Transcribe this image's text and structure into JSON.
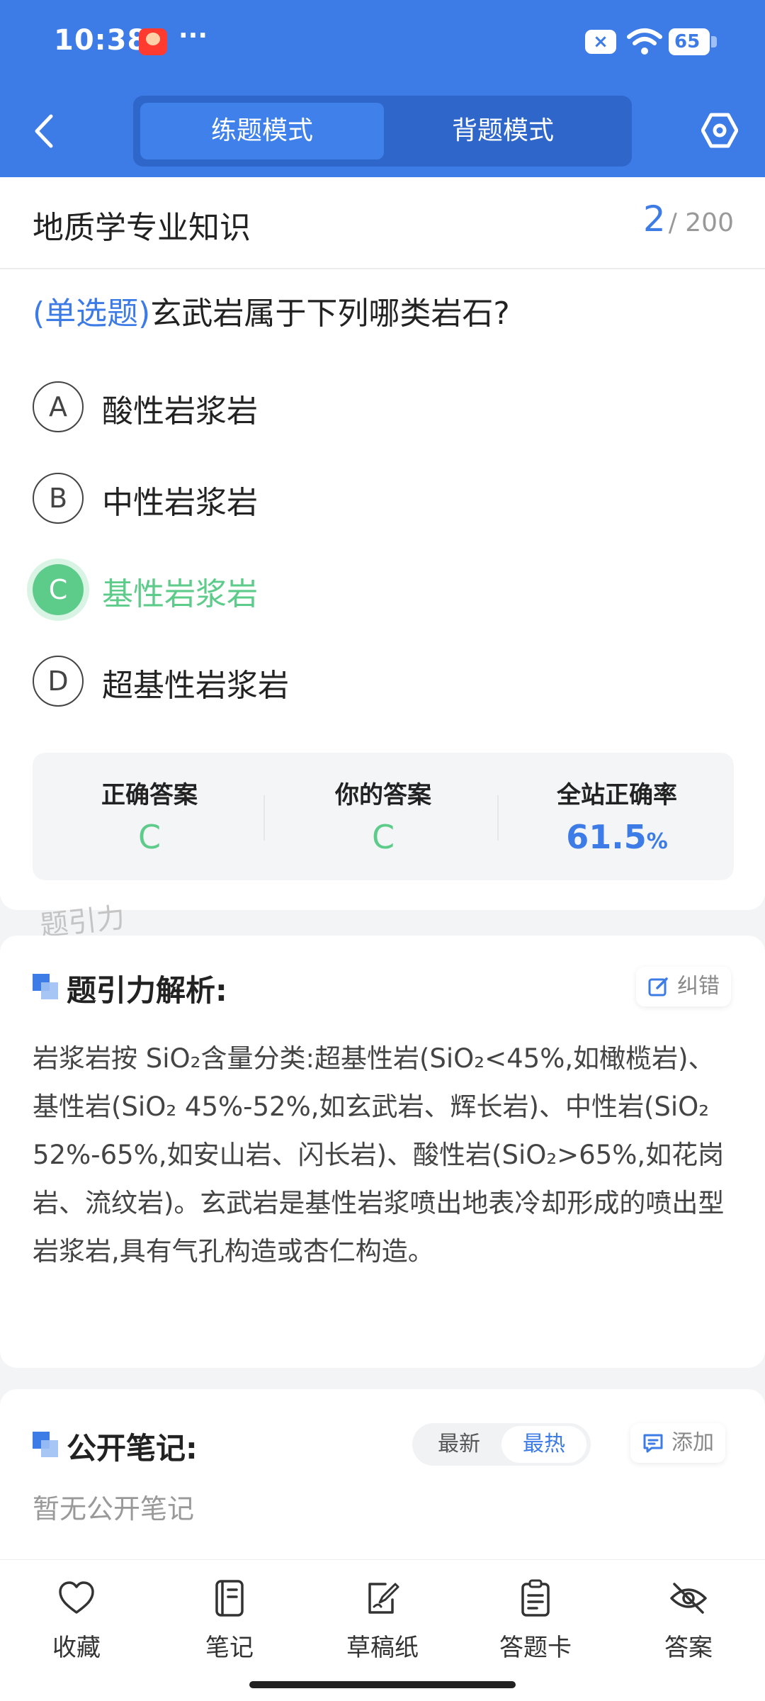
{
  "status_bar": {
    "time": "10:38",
    "dots": "···",
    "battery": "65"
  },
  "header": {
    "tabs": [
      {
        "label": "练题模式",
        "active": true
      },
      {
        "label": "背题模式",
        "active": false
      }
    ]
  },
  "question_header": {
    "course": "地质学专业知识",
    "current": "2",
    "total": "/ 200"
  },
  "question": {
    "type_label": "(单选题)",
    "text": "玄武岩属于下列哪类岩石?",
    "options": [
      {
        "letter": "A",
        "text": "酸性岩浆岩",
        "state": "normal"
      },
      {
        "letter": "B",
        "text": "中性岩浆岩",
        "state": "normal"
      },
      {
        "letter": "C",
        "text": "基性岩浆岩",
        "state": "correct"
      },
      {
        "letter": "D",
        "text": "超基性岩浆岩",
        "state": "normal"
      }
    ]
  },
  "result": {
    "correct_label": "正确答案",
    "correct_value": "C",
    "yours_label": "你的答案",
    "yours_value": "C",
    "rate_label": "全站正确率",
    "rate_value": "61.5",
    "rate_unit": "%"
  },
  "watermark": "题引力",
  "analysis": {
    "title": "题引力解析:",
    "report_label": "纠错",
    "body": "岩浆岩按 SiO₂含量分类:超基性岩(SiO₂<45%,如橄榄岩)、基性岩(SiO₂ 45%-52%,如玄武岩、辉长岩)、中性岩(SiO₂ 52%-65%,如安山岩、闪长岩)、酸性岩(SiO₂>65%,如花岗岩、流纹岩)。玄武岩是基性岩浆喷出地表冷却形成的喷出型岩浆岩,具有气孔构造或杏仁构造。"
  },
  "notes": {
    "title": "公开笔记:",
    "sort_latest": "最新",
    "sort_hot": "最热",
    "add_label": "添加",
    "empty_text": "暂无公开笔记"
  },
  "bottom_nav": [
    {
      "label": "收藏",
      "icon": "heart-icon"
    },
    {
      "label": "笔记",
      "icon": "notebook-icon"
    },
    {
      "label": "草稿纸",
      "icon": "draft-icon"
    },
    {
      "label": "答题卡",
      "icon": "answer-sheet-icon"
    },
    {
      "label": "答案",
      "icon": "eye-off-icon"
    }
  ],
  "colors": {
    "primary": "#3d7be6",
    "correct": "#5dcc8a"
  }
}
